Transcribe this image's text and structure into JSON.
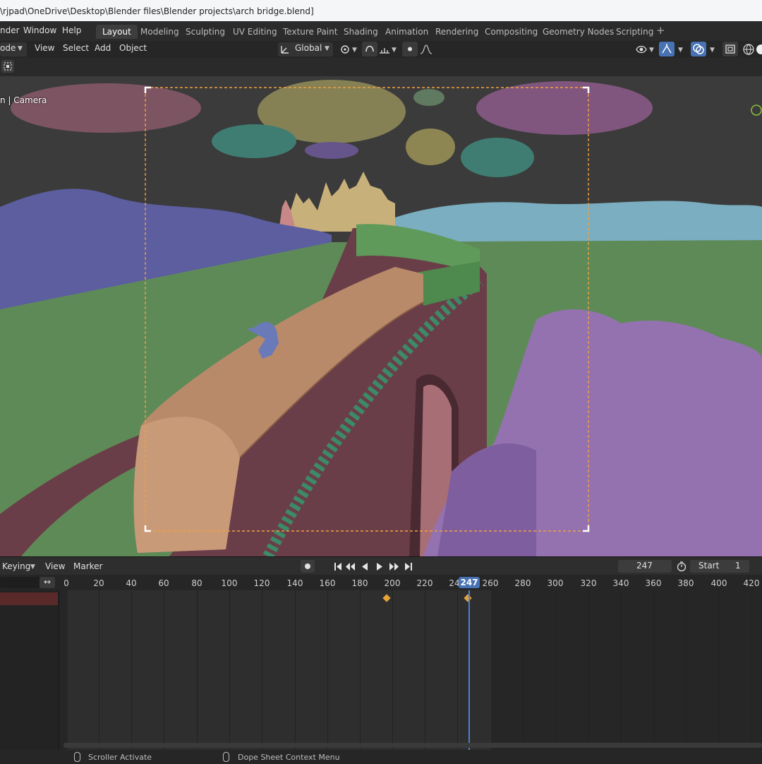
{
  "window": {
    "title": "\\rjpad\\OneDrive\\Desktop\\Blender files\\Blender projects\\arch bridge.blend]"
  },
  "menu": {
    "render": "nder",
    "window": "Window",
    "help": "Help"
  },
  "workspaces": [
    {
      "label": "Layout",
      "active": true
    },
    {
      "label": "Modeling"
    },
    {
      "label": "Sculpting"
    },
    {
      "label": "UV Editing"
    },
    {
      "label": "Texture Paint"
    },
    {
      "label": "Shading"
    },
    {
      "label": "Animation"
    },
    {
      "label": "Rendering"
    },
    {
      "label": "Compositing"
    },
    {
      "label": "Geometry Nodes"
    },
    {
      "label": "Scripting"
    }
  ],
  "viewport_header": {
    "mode": "ode",
    "view": "View",
    "select": "Select",
    "add": "Add",
    "object": "Object",
    "orientation": "Global"
  },
  "viewport": {
    "label": "n | Camera"
  },
  "timeline": {
    "keying": "Keying",
    "view": "View",
    "marker": "Marker",
    "current_frame": "247",
    "start_label": "Start",
    "start_value": "1",
    "ruler": [
      "0",
      "20",
      "40",
      "60",
      "80",
      "100",
      "120",
      "140",
      "160",
      "180",
      "200",
      "220",
      "24",
      "260",
      "280",
      "300",
      "320",
      "340",
      "360",
      "380",
      "400",
      "420"
    ],
    "playhead_label": "247",
    "keyframes": [
      200,
      247
    ]
  },
  "status": {
    "left": "Scroller Activate",
    "right": "Dope Sheet Context Menu"
  },
  "colors": {
    "accent": "#4772b3",
    "keyframe": "#e8a338",
    "camera_frame": "#f0a040"
  }
}
